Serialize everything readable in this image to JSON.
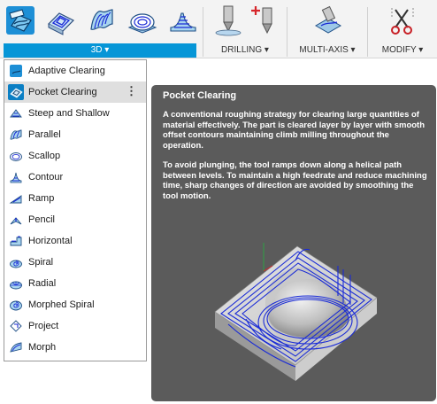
{
  "toolbar": {
    "groups": [
      {
        "label": "3D ▾",
        "active": true
      },
      {
        "label": "DRILLING ▾",
        "active": false
      },
      {
        "label": "MULTI-AXIS ▾",
        "active": false
      },
      {
        "label": "MODIFY ▾",
        "active": false
      }
    ],
    "icons": [
      "adaptive-clearing-icon",
      "pocket-clearing-icon",
      "parallel-icon",
      "scallop-icon",
      "contour-icon",
      "drill-icon",
      "hole-recognition-icon",
      "multi-axis-icon",
      "scissors-icon"
    ]
  },
  "menu": {
    "items": [
      {
        "label": "Adaptive Clearing"
      },
      {
        "label": "Pocket Clearing"
      },
      {
        "label": "Steep and Shallow"
      },
      {
        "label": "Parallel"
      },
      {
        "label": "Scallop"
      },
      {
        "label": "Contour"
      },
      {
        "label": "Ramp"
      },
      {
        "label": "Pencil"
      },
      {
        "label": "Horizontal"
      },
      {
        "label": "Spiral"
      },
      {
        "label": "Radial"
      },
      {
        "label": "Morphed Spiral"
      },
      {
        "label": "Project"
      },
      {
        "label": "Morph"
      }
    ],
    "hovered_index": 1,
    "kebab": "⋮"
  },
  "tooltip": {
    "title": "Pocket Clearing",
    "paragraph1": "A conventional roughing strategy for clearing large quantities of material effectively. The part is cleared layer by layer with smooth offset contours maintaining climb milling throughout the operation.",
    "paragraph2": "To avoid plunging, the tool ramps down along a helical path between levels. To maintain a high feedrate and reduce machining time, sharp changes of direction are avoided by smoothing the tool motion."
  },
  "colors": {
    "accent": "#0696d7",
    "tooltip_bg": "#5b5b5b",
    "toolpath": "#1a2bd6"
  }
}
